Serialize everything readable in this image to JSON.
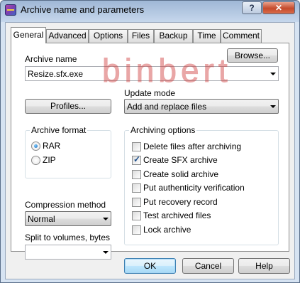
{
  "window": {
    "title": "Archive name and parameters",
    "help_label": "?",
    "close_label": "✕"
  },
  "tabs": [
    "General",
    "Advanced",
    "Options",
    "Files",
    "Backup",
    "Time",
    "Comment"
  ],
  "archive_name": {
    "label": "Archive name",
    "value": "Resize.sfx.exe",
    "browse_label": "Browse..."
  },
  "profiles_label": "Profiles...",
  "update_mode": {
    "label": "Update mode",
    "value": "Add and replace files"
  },
  "archive_format": {
    "title": "Archive format",
    "options": [
      "RAR",
      "ZIP"
    ],
    "selected": "RAR"
  },
  "archiving_options": {
    "title": "Archiving options",
    "items": [
      {
        "label": "Delete files after archiving",
        "checked": false
      },
      {
        "label": "Create SFX archive",
        "checked": true
      },
      {
        "label": "Create solid archive",
        "checked": false
      },
      {
        "label": "Put authenticity verification",
        "checked": false
      },
      {
        "label": "Put recovery record",
        "checked": false
      },
      {
        "label": "Test archived files",
        "checked": false
      },
      {
        "label": "Lock archive",
        "checked": false
      }
    ]
  },
  "compression": {
    "label": "Compression method",
    "value": "Normal"
  },
  "split": {
    "label": "Split to volumes, bytes",
    "value": ""
  },
  "buttons": {
    "ok": "OK",
    "cancel": "Cancel",
    "help": "Help"
  },
  "watermark": "binbert",
  "colors": {
    "watermark": "#cf3b3b",
    "accent": "#3c7fb1"
  }
}
